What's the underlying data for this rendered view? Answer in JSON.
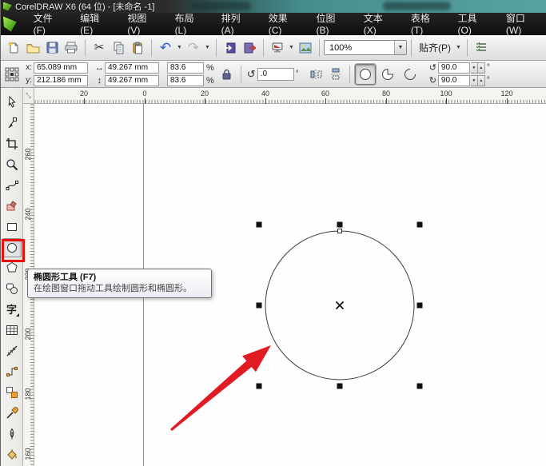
{
  "window": {
    "title": "CorelDRAW X6 (64 位) - [未命名 -1]"
  },
  "menu": {
    "items": [
      "文件(F)",
      "编辑(E)",
      "视图(V)",
      "布局(L)",
      "排列(A)",
      "效果(C)",
      "位图(B)",
      "文本(X)",
      "表格(T)",
      "工具(O)",
      "窗口(W)"
    ]
  },
  "toolbar": {
    "zoom_level": "100%",
    "snap_label": "贴齐(P)"
  },
  "property_bar": {
    "x_label": "x:",
    "y_label": "y:",
    "x_value": "65.089 mm",
    "y_value": "212.186 mm",
    "width_value": "49.267 mm",
    "height_value": "49.267 mm",
    "width_icon": "↔",
    "height_icon": "↕",
    "scale_h": "83.6",
    "scale_v": "83.6",
    "percent": "%",
    "rotation_value": ".0",
    "degree": "°",
    "start_angle": "90.0",
    "end_angle": "90.0"
  },
  "toolbox": {
    "text_tool_glyph": "字"
  },
  "rulers": {
    "top_labels": [
      "20",
      "0",
      "20",
      "40",
      "60",
      "80",
      "100",
      "120"
    ],
    "left_labels": [
      "260",
      "240",
      "220",
      "200",
      "180",
      "160"
    ]
  },
  "tooltip": {
    "title": "椭圆形工具 (F7)",
    "body": "在绘图窗口拖动工具绘制圆形和椭圆形。"
  },
  "colors": {
    "annotation_red": "#e8100c",
    "arrow_red": "#e01b24",
    "selection_handle": "#111111",
    "titlebar_teal": "#4f9797"
  }
}
